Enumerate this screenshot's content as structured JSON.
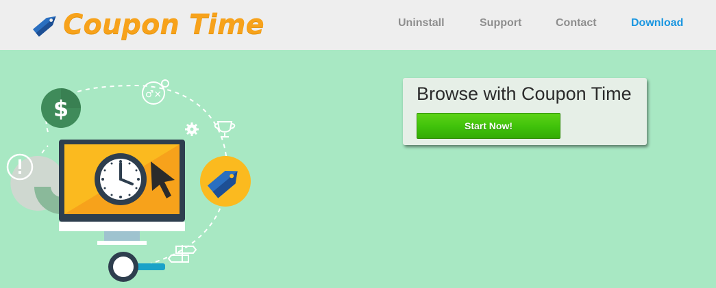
{
  "brand": {
    "name": "Coupon Time",
    "colors": {
      "logo_text": "#f7a21b",
      "tag_blue": "#2a6fc0",
      "accent_link": "#1a96e0"
    }
  },
  "nav": {
    "items": [
      {
        "label": "Uninstall"
      },
      {
        "label": "Support"
      },
      {
        "label": "Contact"
      },
      {
        "label": "Download"
      }
    ]
  },
  "hero": {
    "illustration_icons": [
      "dollar-icon",
      "strategy-icon",
      "gear-icon",
      "trophy-icon",
      "alert-icon",
      "clock-icon",
      "cursor-icon",
      "price-tag-icon",
      "magnifier-icon",
      "signpost-icon"
    ],
    "background": "#a8e8c3"
  },
  "cta": {
    "title": "Browse with Coupon Time",
    "button_label": "Start Now!",
    "button_color": "#3fc10a"
  }
}
